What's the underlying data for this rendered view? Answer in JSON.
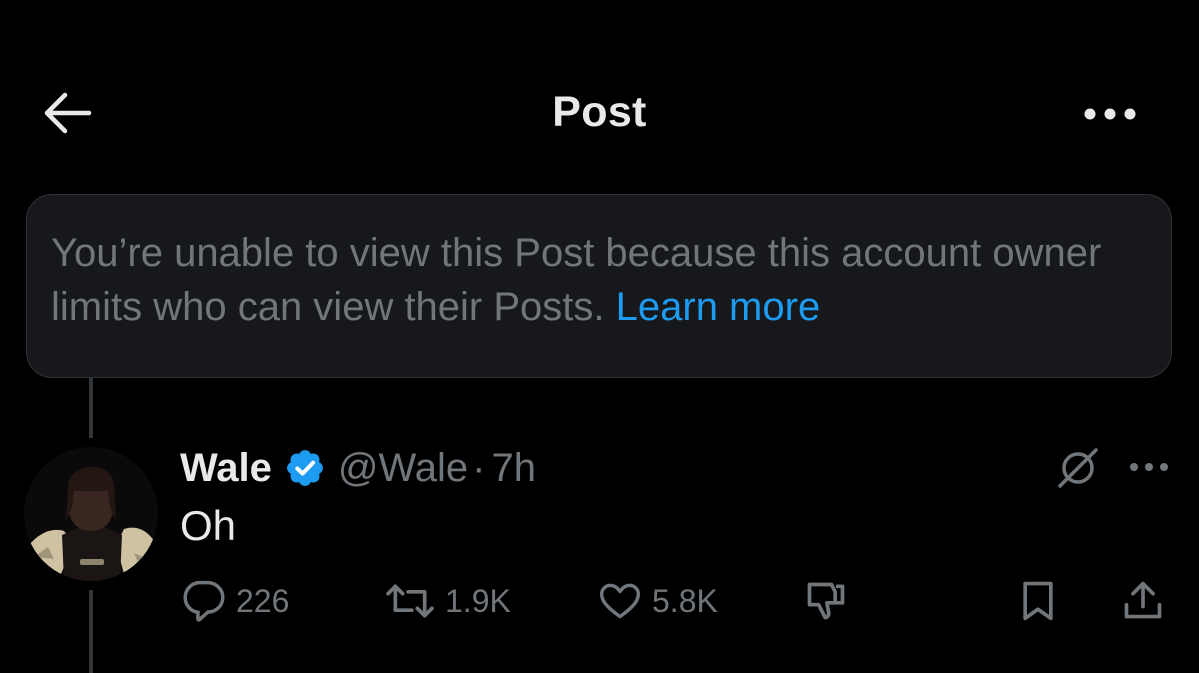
{
  "header": {
    "title": "Post",
    "back_icon": "arrow-left-icon",
    "more_icon": "more-horizontal-icon"
  },
  "notice": {
    "text": "You’re unable to view this Post because this account owner limits who can view their Posts.",
    "link": "Learn more",
    "link_color": "#1d9bf0"
  },
  "post": {
    "author": {
      "name": "Wale",
      "handle": "@Wale",
      "verified": true,
      "verified_color": "#1d9bf0"
    },
    "separator": "·",
    "time": "7h",
    "text": "Oh",
    "actions": {
      "replies": "226",
      "reposts": "1.9K",
      "likes": "5.8K"
    }
  },
  "colors": {
    "background": "#000000",
    "text_primary": "#e7e9ea",
    "text_secondary": "#71767b",
    "card_background": "#16181c",
    "border": "#2f3336",
    "accent": "#1d9bf0"
  }
}
